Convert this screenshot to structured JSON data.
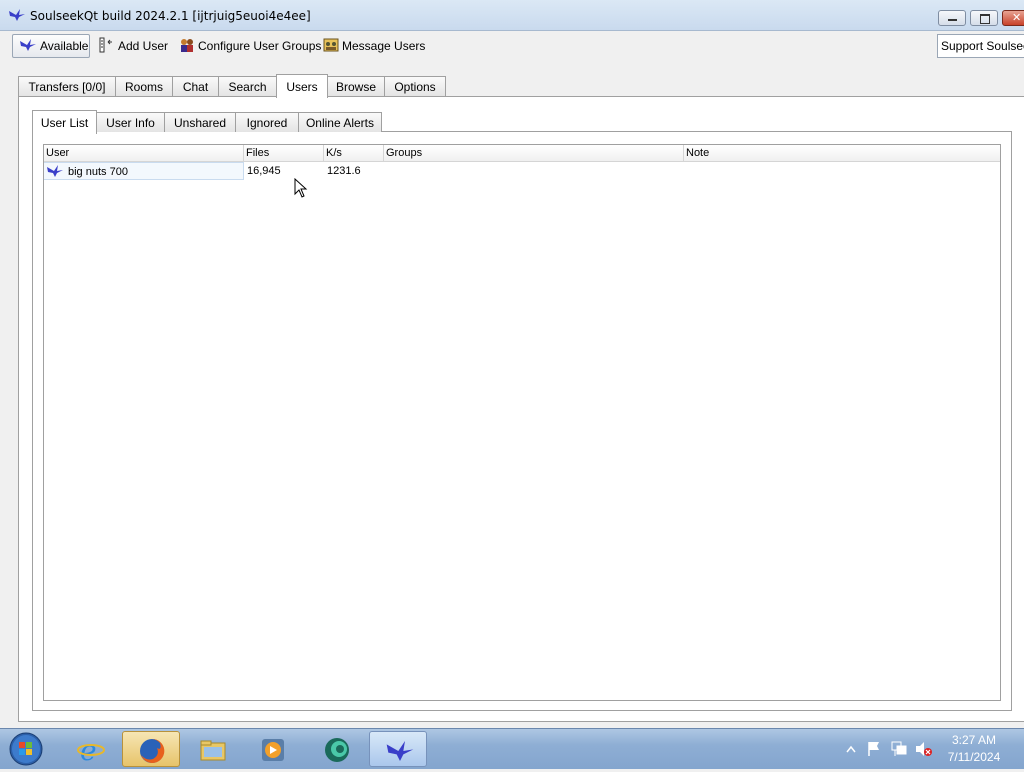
{
  "window": {
    "title": "SoulseekQt build 2024.2.1 [ijtrjuig5euoi4e4ee]"
  },
  "toolbar": {
    "status_label": "Available",
    "add_user_label": "Add User",
    "configure_groups_label": "Configure User Groups",
    "message_users_label": "Message Users",
    "support_label": "Support Soulseek"
  },
  "main_tabs": [
    {
      "label": "Transfers [0/0]"
    },
    {
      "label": "Rooms"
    },
    {
      "label": "Chat"
    },
    {
      "label": "Search"
    },
    {
      "label": "Users",
      "active": true
    },
    {
      "label": "Browse"
    },
    {
      "label": "Options"
    }
  ],
  "sub_tabs": [
    {
      "label": "User List",
      "active": true
    },
    {
      "label": "User Info"
    },
    {
      "label": "Unshared"
    },
    {
      "label": "Ignored"
    },
    {
      "label": "Online Alerts"
    }
  ],
  "user_table": {
    "columns": [
      "User",
      "Files",
      "K/s",
      "Groups",
      "Note"
    ],
    "rows": [
      {
        "user": "big nuts 700",
        "files": "16,945",
        "speed": "1231.6",
        "groups": "",
        "note": ""
      }
    ]
  },
  "taskbar": {
    "time": "3:27 AM",
    "date": "7/11/2024"
  },
  "colors": {
    "titlebar": "#c9daee",
    "taskbar": "#8eaed4",
    "soulseek_bird": "#3a3fc9"
  }
}
